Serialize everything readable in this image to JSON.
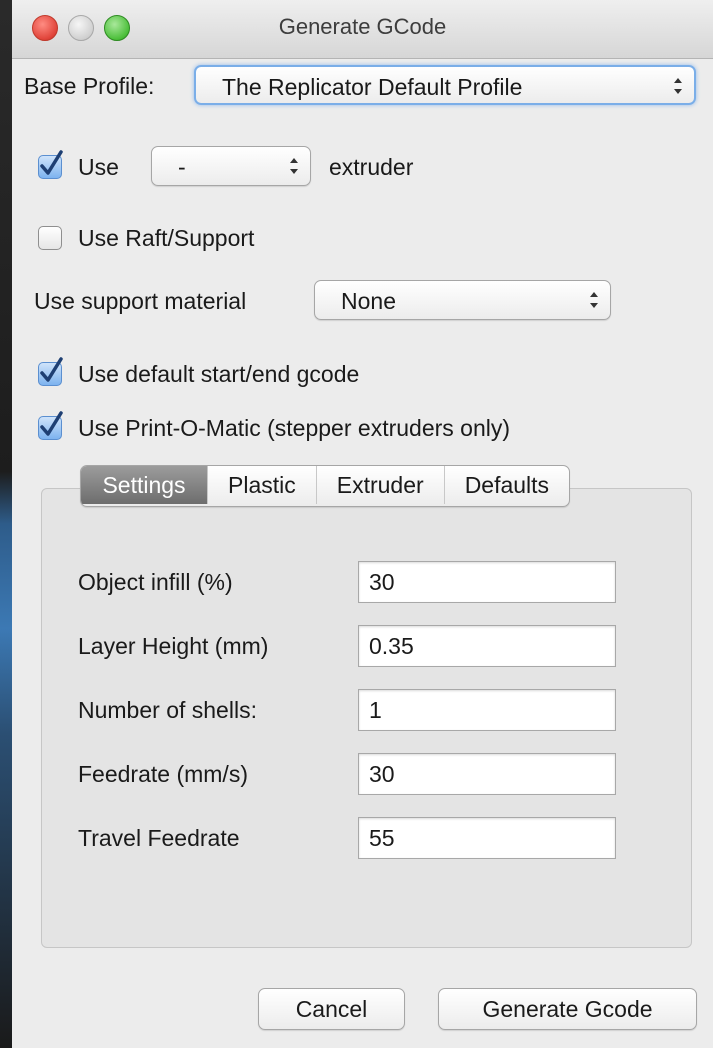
{
  "window": {
    "title": "Generate GCode"
  },
  "base_profile": {
    "label": "Base Profile:",
    "value": "The Replicator Default Profile"
  },
  "extruder_row": {
    "checkbox_label": "Use",
    "checked": true,
    "select_value": "-",
    "suffix": "extruder"
  },
  "raft": {
    "label": "Use Raft/Support",
    "checked": false
  },
  "support": {
    "label": "Use support material",
    "value": "None"
  },
  "default_gcode": {
    "label": "Use default start/end gcode",
    "checked": true
  },
  "print_o_matic": {
    "label": "Use Print-O-Matic (stepper extruders only)",
    "checked": true
  },
  "tabs": [
    {
      "label": "Settings",
      "active": true
    },
    {
      "label": "Plastic",
      "active": false
    },
    {
      "label": "Extruder",
      "active": false
    },
    {
      "label": "Defaults",
      "active": false
    }
  ],
  "settings": [
    {
      "label": "Object infill (%)",
      "value": "30"
    },
    {
      "label": "Layer Height (mm)",
      "value": "0.35"
    },
    {
      "label": "Number of shells:",
      "value": "1"
    },
    {
      "label": "Feedrate (mm/s)",
      "value": "30"
    },
    {
      "label": "Travel Feedrate",
      "value": "55"
    }
  ],
  "buttons": {
    "cancel": "Cancel",
    "generate": "Generate Gcode"
  },
  "colors": {
    "accent": "#4a90e2",
    "active_tab": "#7a7a7a",
    "close_button": "#e0443a",
    "zoom_button": "#4cbf3a"
  }
}
